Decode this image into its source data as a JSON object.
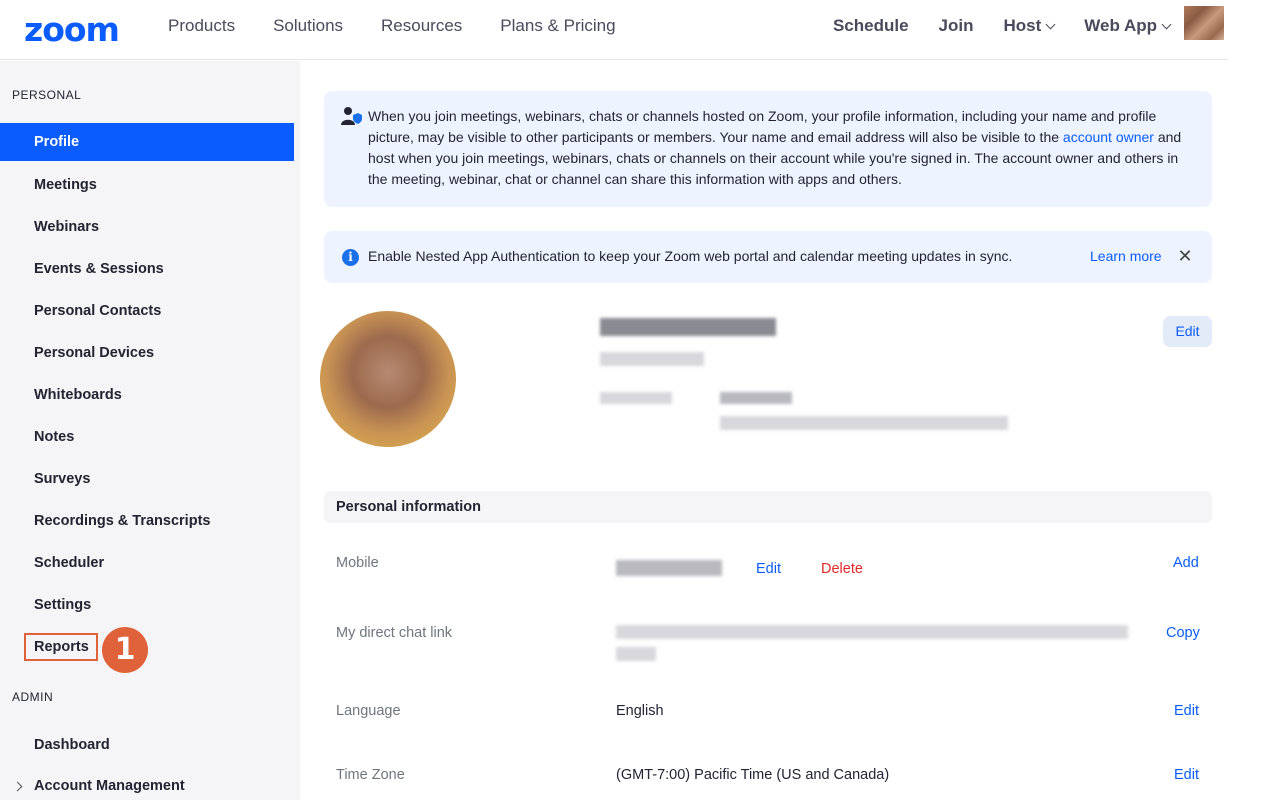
{
  "topnav": {
    "logo": "zoom",
    "left_items": [
      "Products",
      "Solutions",
      "Resources",
      "Plans & Pricing"
    ],
    "schedule": "Schedule",
    "join": "Join",
    "host": "Host",
    "web_app": "Web App"
  },
  "sidebar": {
    "personal_heading": "PERSONAL",
    "items": [
      "Profile",
      "Meetings",
      "Webinars",
      "Events & Sessions",
      "Personal Contacts",
      "Personal Devices",
      "Whiteboards",
      "Notes",
      "Surveys",
      "Recordings & Transcripts",
      "Scheduler",
      "Settings",
      "Reports"
    ],
    "active_item": "Profile",
    "admin_heading": "ADMIN",
    "admin_items": [
      "Dashboard",
      "Account Management"
    ],
    "step_badge": "1"
  },
  "notice_privacy": {
    "text_before": "When you join meetings, webinars, chats or channels hosted on Zoom, your profile information, including your name and profile picture, may be visible to other participants or members. Your name and email address will also be visible to the ",
    "link": "account owner",
    "text_after": " and host when you join meetings, webinars, chats or channels on their account while you're signed in. The account owner and others in the meeting, webinar, chat or channel can share this information with apps and others."
  },
  "notice_nested": {
    "text": "Enable Nested App Authentication to keep your Zoom web portal and calendar meeting updates in sync.",
    "learn_more": "Learn more"
  },
  "profile": {
    "edit_label": "Edit"
  },
  "personal_info": {
    "heading": "Personal information",
    "mobile_label": "Mobile",
    "mobile_edit": "Edit",
    "mobile_delete": "Delete",
    "mobile_add": "Add",
    "chat_link_label": "My direct chat link",
    "chat_link_copy": "Copy",
    "language_label": "Language",
    "language_value": "English",
    "language_edit": "Edit",
    "timezone_label": "Time Zone",
    "timezone_value": "(GMT-7:00) Pacific Time (US and Canada)",
    "timezone_edit": "Edit"
  },
  "colors": {
    "brand": "#0b5cff",
    "highlight": "#e0623a",
    "danger": "#e02828"
  }
}
